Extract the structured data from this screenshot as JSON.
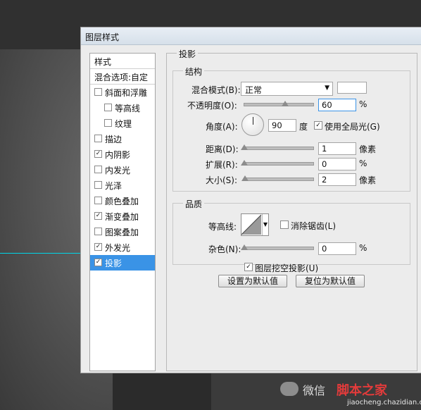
{
  "dialog": {
    "title": "图层样式"
  },
  "left_panel": {
    "header": "样式",
    "blend_options": "混合选项:自定",
    "items": [
      {
        "label": "斜面和浮雕",
        "checked": false,
        "indent": false
      },
      {
        "label": "等高线",
        "checked": false,
        "indent": true
      },
      {
        "label": "纹理",
        "checked": false,
        "indent": true
      },
      {
        "label": "描边",
        "checked": false,
        "indent": false
      },
      {
        "label": "内阴影",
        "checked": true,
        "indent": false
      },
      {
        "label": "内发光",
        "checked": false,
        "indent": false
      },
      {
        "label": "光泽",
        "checked": false,
        "indent": false
      },
      {
        "label": "颜色叠加",
        "checked": false,
        "indent": false
      },
      {
        "label": "渐变叠加",
        "checked": true,
        "indent": false
      },
      {
        "label": "图案叠加",
        "checked": false,
        "indent": false
      },
      {
        "label": "外发光",
        "checked": true,
        "indent": false
      },
      {
        "label": "投影",
        "checked": true,
        "indent": false,
        "selected": true
      }
    ]
  },
  "drop_shadow": {
    "section_title": "投影",
    "structure": {
      "group_title": "结构",
      "blend_mode_label": "混合模式(B):",
      "blend_mode_value": "正常",
      "shadow_color": "#ffffff",
      "opacity_label": "不透明度(O):",
      "opacity_value": "60",
      "opacity_unit": "%",
      "opacity_fraction": 0.6,
      "angle_label": "角度(A):",
      "angle_value": "90",
      "angle_unit": "度",
      "global_light_label": "使用全局光(G)",
      "global_light_checked": true,
      "distance_label": "距离(D):",
      "distance_value": "1",
      "distance_unit": "像素",
      "spread_label": "扩展(R):",
      "spread_value": "0",
      "spread_unit": "%",
      "size_label": "大小(S):",
      "size_value": "2",
      "size_unit": "像素"
    },
    "quality": {
      "group_title": "品质",
      "contour_label": "等高线:",
      "anti_alias_label": "消除锯齿(L)",
      "anti_alias_checked": false,
      "noise_label": "杂色(N):",
      "noise_value": "0",
      "noise_unit": "%"
    },
    "knockout_label": "图层挖空投影(U)",
    "knockout_checked": true,
    "make_default_button": "设置为默认值",
    "reset_default_button": "复位为默认值"
  },
  "watermark": {
    "text": "微信",
    "brand": "脚本之家",
    "site": "jiaocheng.chazidian.com"
  }
}
